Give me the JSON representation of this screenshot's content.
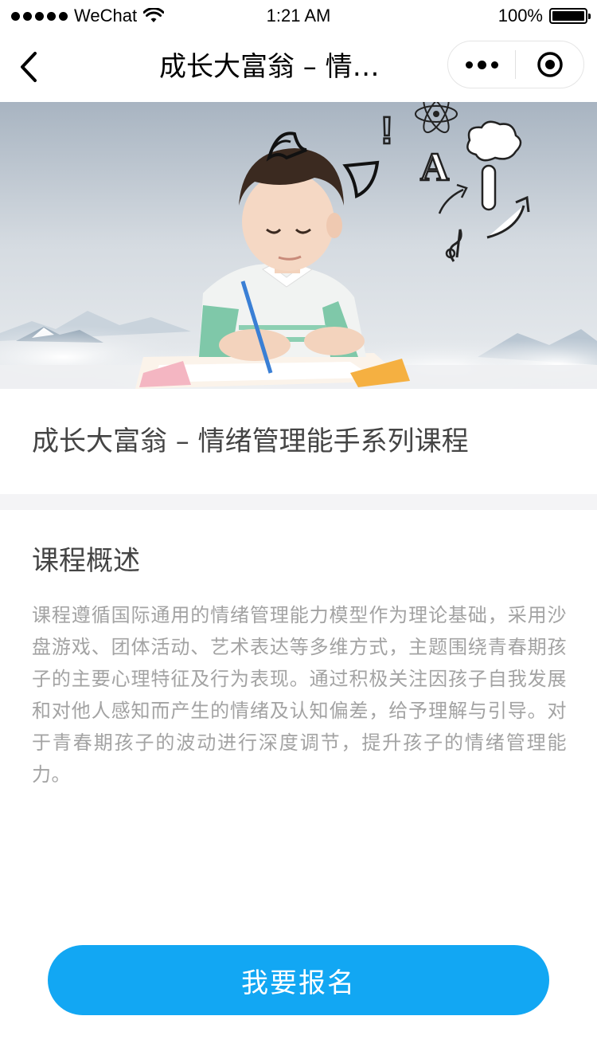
{
  "status_bar": {
    "carrier": "WeChat",
    "time": "1:21 AM",
    "battery": "100%"
  },
  "nav": {
    "title": "成长大富翁 – 情…",
    "back_icon": "chevron-left-icon",
    "more_icon": "more-dots-icon",
    "close_icon": "target-close-icon"
  },
  "banner": {
    "image": "child-drawing-clouds-illustration",
    "doodle_text": [
      "!",
      "A"
    ]
  },
  "course": {
    "title": "成长大富翁 – 情绪管理能手系列课程"
  },
  "overview": {
    "heading": "课程概述",
    "body": "课程遵循国际通用的情绪管理能力模型作为理论基础，采用沙盘游戏、团体活动、艺术表达等多维方式，主题围绕青春期孩子的主要心理特征及行为表现。通过积极关注因孩子自我发展和对他人感知而产生的情绪及认知偏差，给予理解与引导。对于青春期孩子的波动进行深度调节，提升孩子的情绪管理能力。"
  },
  "actions": {
    "signup_label": "我要报名"
  },
  "colors": {
    "accent": "#12a7f3",
    "text_primary": "#444444",
    "text_secondary": "#a3a3a3",
    "divider": "#f4f4f6"
  }
}
